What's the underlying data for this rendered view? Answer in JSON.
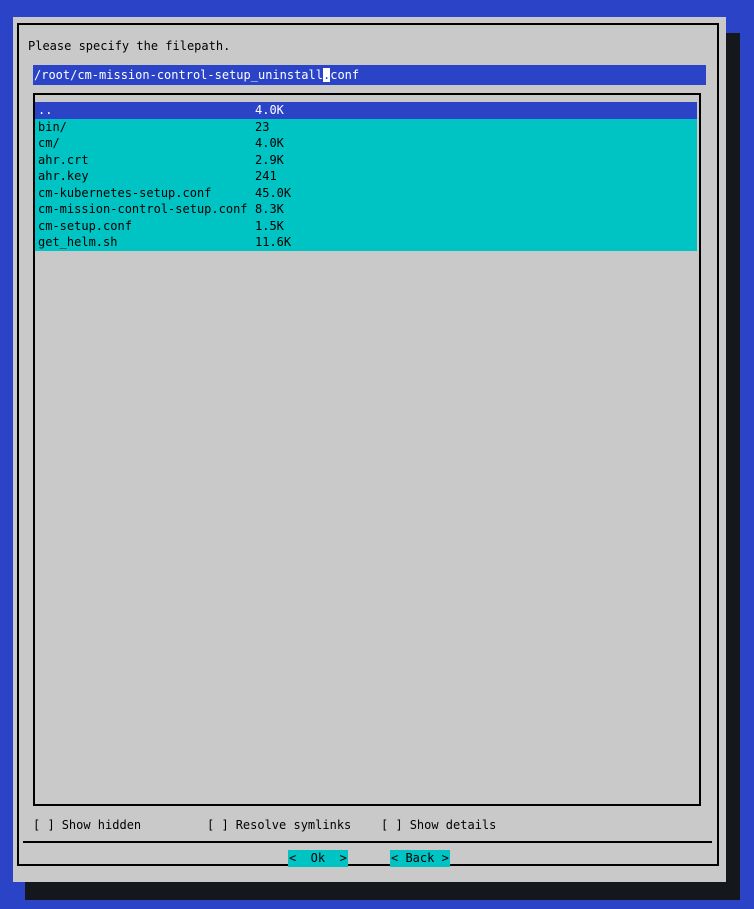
{
  "dialog": {
    "title": "Please specify the filepath.",
    "input": {
      "before_cursor": "/root/cm-mission-control-setup_uninstall",
      "cursor_char": ".",
      "after_cursor": "conf",
      "value": "/root/cm-mission-control-setup_uninstall.conf"
    },
    "files": [
      {
        "name": "..",
        "size": "4.0K",
        "selected": true
      },
      {
        "name": "bin/",
        "size": "23",
        "selected": false
      },
      {
        "name": "cm/",
        "size": "4.0K",
        "selected": false
      },
      {
        "name": "ahr.crt",
        "size": "2.9K",
        "selected": false
      },
      {
        "name": "ahr.key",
        "size": "241",
        "selected": false
      },
      {
        "name": "cm-kubernetes-setup.conf",
        "size": "45.0K",
        "selected": false
      },
      {
        "name": "cm-mission-control-setup.conf",
        "size": "8.3K",
        "selected": false
      },
      {
        "name": "cm-setup.conf",
        "size": "1.5K",
        "selected": false
      },
      {
        "name": "get_helm.sh",
        "size": "11.6K",
        "selected": false
      }
    ],
    "checkboxes": [
      {
        "glyph": "[ ]",
        "label": "Show hidden",
        "checked": false
      },
      {
        "glyph": "[ ]",
        "label": "Resolve symlinks",
        "checked": false
      },
      {
        "glyph": "[ ]",
        "label": "Show details",
        "checked": false
      }
    ],
    "buttons": [
      {
        "label": "Ok",
        "text": "<  Ok  >"
      },
      {
        "label": "Back",
        "text": "< Back >"
      }
    ]
  },
  "colors": {
    "screen_blue": "#2b44c7",
    "dialog_gray": "#c9c9c9",
    "highlight_blue": "#2b44c7",
    "cyan": "#00c3c4",
    "shadow": "#14171b",
    "black": "#000000",
    "white": "#ffffff"
  }
}
